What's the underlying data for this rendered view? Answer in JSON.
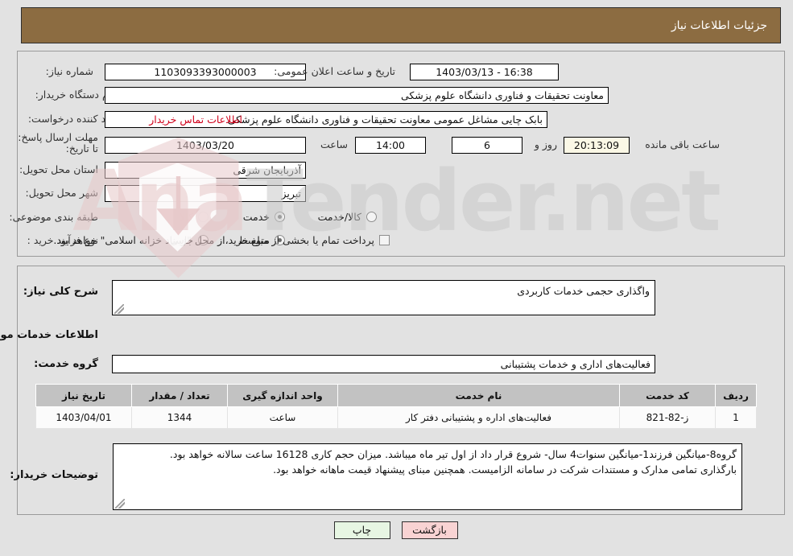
{
  "header": {
    "title": "جزئیات اطلاعات نیاز"
  },
  "top_section": {
    "need_number": {
      "label": "شماره نیاز:",
      "value": "1103093393000003"
    },
    "announce_datetime": {
      "label": "تاریخ و ساعت اعلان عمومی:",
      "value": "16:38 - 1403/03/13"
    },
    "buyer_org": {
      "label": "نام دستگاه خریدار:",
      "value": "معاونت تحقیقات و فناوری دانشگاه علوم پزشکی"
    },
    "requester": {
      "label": "ایجاد کننده درخواست:",
      "value": "بابک چایی مشاغل عمومی معاونت تحقیقات و فناوری دانشگاه علوم پزشکی"
    },
    "contact_link": {
      "label": "اطلاعات تماس خریدار"
    },
    "deadline": {
      "label": "مهلت ارسال پاسخ: تا تاریخ:",
      "date": "1403/03/20",
      "hour_label": "ساعت",
      "hour_value": "14:00",
      "days_value": "6",
      "days_label": "روز و",
      "countdown_value": "20:13:09",
      "countdown_label": "ساعت باقی مانده"
    },
    "province": {
      "label": "استان محل تحویل:",
      "value": "آذربایجان شرقی"
    },
    "city": {
      "label": "شهر محل تحویل:",
      "value": "تبریز"
    },
    "category": {
      "label": "طبقه بندی موضوعی:",
      "options": [
        {
          "label": "کالا",
          "selected": false
        },
        {
          "label": "خدمت",
          "selected": true
        },
        {
          "label": "کالا/خدمت",
          "selected": false
        }
      ]
    },
    "process_type": {
      "label": "نوع فرآیند خرید :",
      "options": [
        {
          "label": "جزیی",
          "selected": false
        },
        {
          "label": "متوسط",
          "selected": true
        }
      ]
    },
    "treasury_note": {
      "checked": false,
      "text": "پرداخت تمام یا بخشی از مبلغ خرید،از محل \"اسناد خزانه اسلامی\" خواهد بود."
    }
  },
  "bottom_section": {
    "general_desc": {
      "label": "شرح کلی نیاز:",
      "value": "واگذاری حجمی خدمات کاربردی"
    },
    "services_heading": "اطلاعات خدمات مورد نیاز",
    "service_group": {
      "label": "گروه خدمت:",
      "value": "فعالیت‌های اداری و خدمات پشتیبانی"
    },
    "table": {
      "columns": [
        "ردیف",
        "کد خدمت",
        "نام خدمت",
        "واحد اندازه گیری",
        "تعداد / مقدار",
        "تاریخ نیاز"
      ],
      "rows": [
        {
          "row": "1",
          "code": "ز-82-821",
          "name": "فعالیت‌های اداره و پشتیبانی دفتر کار",
          "unit": "ساعت",
          "quantity": "1344",
          "need_date": "1403/04/01"
        }
      ]
    },
    "buyer_notes": {
      "label": "توضیحات خریدار:",
      "line1": "گروه8-میانگین فرزند1-میانگین سنوات4 سال- شروع قرار داد از اول تیر ماه میباشد. میزان حجم کاری 16128 ساعت سالانه خواهد بود.",
      "line2": "بارگذاری تمامی مدارک و مستندات شرکت در سامانه الزامیست. همچنین مبنای پیشنهاد قیمت ماهانه خواهد بود."
    }
  },
  "footer": {
    "print_label": "چاپ",
    "back_label": "بازگشت"
  },
  "watermark": {
    "text_left": "Ana",
    "text_right": "Tender.net"
  },
  "colors": {
    "header_brown": "#8c6c41",
    "page_bg": "#e2e2e2",
    "link_red": "#d0021b",
    "table_header": "#c2c2c2",
    "print_btn": "#e7f6e3",
    "back_btn": "#f9d3d3",
    "countdown_bg": "#fbf8e6"
  }
}
